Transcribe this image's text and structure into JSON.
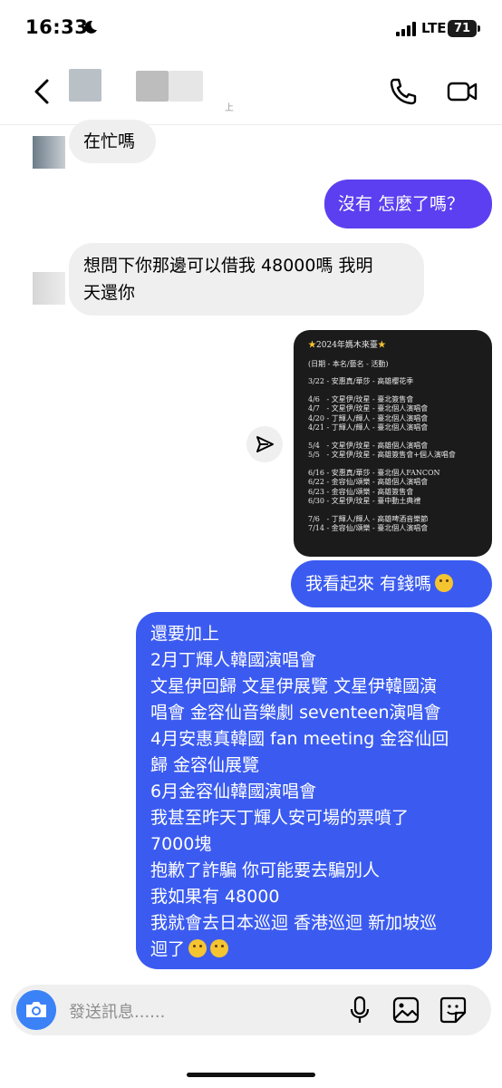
{
  "status_bar": {
    "time": "16:33",
    "network": "LTE",
    "battery": "71"
  },
  "header": {
    "subtitle": "上"
  },
  "messages": {
    "m1": "在忙嗎",
    "m2": "沒有 怎麼了嗎？",
    "m3_line1": "想問下你那邊可以借我 48000嗎 我明",
    "m3_line2": "天還你",
    "m5": "我看起來 有錢嗎",
    "m6": [
      "還要加上",
      "2月丁輝人韓國演唱會",
      "文星伊回歸 文星伊展覽 文星伊韓國演",
      "唱會 金容仙音樂劇 seventeen演唱會",
      "4月安惠真韓國 fan meeting 金容仙回",
      "歸 金容仙展覽",
      "6月金容仙韓國演唱會",
      "我甚至昨天丁輝人安可場的票噴了",
      "7000塊",
      "抱歉了詐騙 你可能要去騙別人",
      "我如果有 48000",
      "我就會去日本巡迴 香港巡迴 新加坡巡",
      "迴了"
    ]
  },
  "image_card": {
    "title": "2024年媽木來臺",
    "subtitle": "(日期 - 本名/藝名 - 活動)",
    "groups": [
      [
        "3/22 - 安惠真/華莎 - 高雄櫻花季"
      ],
      [
        "4/6   - 文星伊/玟星 - 臺北簽售會",
        "4/7   - 文星伊/玟星 - 臺北個人演唱會",
        "4/20 - 丁輝人/輝人 - 臺北個人演唱會",
        "4/21 - 丁輝人/輝人 - 臺北個人演唱會"
      ],
      [
        "5/4   - 文星伊/玟星 - 高雄個人演唱會",
        "5/5   - 文星伊/玟星 - 高雄簽售會+個人演唱會"
      ],
      [
        "6/16 - 安惠真/華莎 - 臺北個人FANCON",
        "6/22 - 金容仙/頌樂 - 高雄個人演唱會",
        "6/23 - 金容仙/頌樂 - 高雄簽售會",
        "6/30 - 文星伊/玟星 - 臺中動土典禮"
      ],
      [
        "7/6   - 丁輝人/輝人 - 高雄啤酒音樂節",
        "7/14 - 金容仙/頌樂 - 臺北個人演唱會"
      ]
    ]
  },
  "composer": {
    "placeholder": "發送訊息......"
  },
  "icons": {
    "back": "chevron-left-icon",
    "call": "phone-icon",
    "video": "video-camera-icon",
    "forward": "send-arrow-icon",
    "camera": "camera-icon",
    "mic": "microphone-icon",
    "gallery": "image-icon",
    "sticker": "sticker-icon",
    "emoji_crying": "crying-face-emoji",
    "emoji_sobbing": "loudly-crying-face-emoji"
  },
  "colors": {
    "outgoing_blue": "#3b5bf0",
    "outgoing_purple": "#5b3ff0",
    "incoming_gray": "#efefef",
    "camera_blue": "#3b82f6"
  }
}
